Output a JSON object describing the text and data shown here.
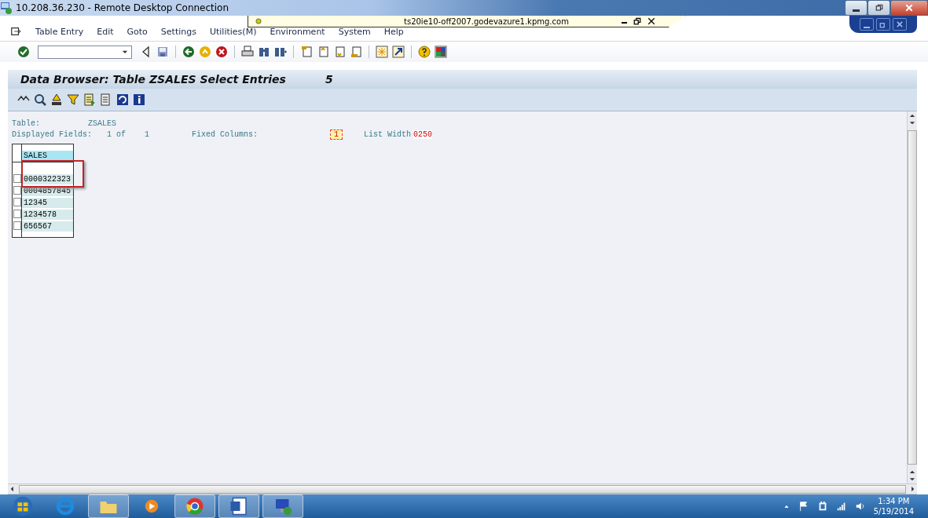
{
  "window": {
    "title": "10.208.36.230 - Remote Desktop Connection"
  },
  "connection_bar": {
    "host": "ts20ie10-off2007.godevazure1.kpmg.com"
  },
  "menu": [
    "Table Entry",
    "Edit",
    "Goto",
    "Settings",
    "Utilities(M)",
    "Environment",
    "System",
    "Help"
  ],
  "screen_title": {
    "text": "Data Browser: Table ZSALES Select Entries",
    "count": "5"
  },
  "info": {
    "table_label": "Table:",
    "table_value": "ZSALES",
    "fields_label": "Displayed Fields:",
    "fields_shown": "1",
    "fields_of": "of",
    "fields_total": "1",
    "fixed_label": "Fixed Columns:",
    "fixed_value": "1",
    "width_label": "List Width",
    "width_value": "0250"
  },
  "table": {
    "columns": [
      "SALES"
    ],
    "rows": [
      {
        "value": "0000322323",
        "selected": false
      },
      {
        "value": "0004857845",
        "selected": false
      },
      {
        "value": "12345",
        "selected": false
      },
      {
        "value": "1234578",
        "selected": false
      },
      {
        "value": "656567",
        "selected": false
      }
    ]
  },
  "clock": {
    "time": "1:34 PM",
    "date": "5/19/2014"
  }
}
